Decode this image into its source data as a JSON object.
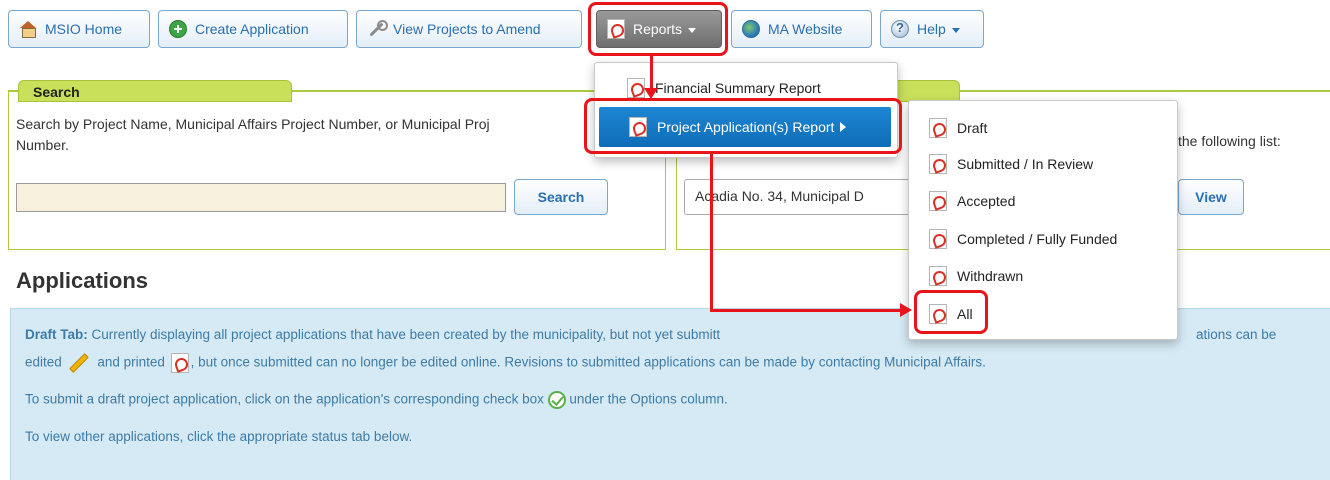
{
  "nav": {
    "home": "MSIO Home",
    "create": "Create Application",
    "amend": "View Projects to Amend",
    "reports": "Reports",
    "website": "MA Website",
    "help": "Help"
  },
  "search_panel": {
    "title": "Search",
    "description_line1": "Search by Project Name, Municipal Affairs Project Number, or Municipal Proj",
    "description_line2": "Number.",
    "input_value": "",
    "button": "Search"
  },
  "view_panel": {
    "description_tail": "the following list:",
    "selected_value": "Acadia No. 34, Municipal D",
    "button": "View"
  },
  "reports_menu": {
    "items": [
      {
        "label": "Financial Summary Report"
      },
      {
        "label": "Project Application(s) Report"
      }
    ]
  },
  "submenu": {
    "items": [
      {
        "label": "Draft"
      },
      {
        "label": "Submitted / In Review"
      },
      {
        "label": "Accepted"
      },
      {
        "label": "Completed / Fully Funded"
      },
      {
        "label": "Withdrawn"
      },
      {
        "label": "All"
      }
    ]
  },
  "applications": {
    "heading": "Applications",
    "line1_bold": "Draft Tab:",
    "line1_text": " Currently displaying all project applications that have been created by the municipality, but not yet submitt",
    "line1_tail": "ations can be",
    "line2_a": "edited",
    "line2_b": " and printed",
    "line2_c": ", but once submitted can no longer be edited online. Revisions to submitted applications can be made by contacting Municipal Affairs.",
    "line3_a": "To submit a draft project application, click on the application's corresponding check box",
    "line3_b": " under the Options column.",
    "line4": "To view other applications, click the appropriate status tab below."
  }
}
